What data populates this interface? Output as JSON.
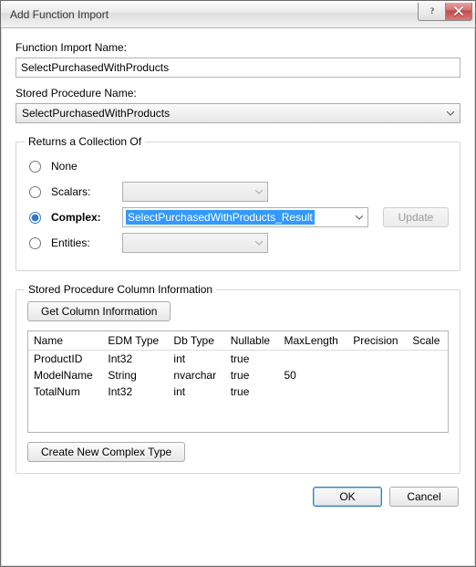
{
  "window": {
    "title": "Add Function Import"
  },
  "import": {
    "name_label": "Function Import Name:",
    "name_value": "SelectPurchasedWithProducts",
    "proc_label": "Stored Procedure Name:",
    "proc_value": "SelectPurchasedWithProducts"
  },
  "returns": {
    "legend": "Returns a Collection Of",
    "none_label": "None",
    "scalars_label": "Scalars:",
    "complex_label": "Complex:",
    "entities_label": "Entities:",
    "complex_value": "SelectPurchasedWithProducts_Result",
    "update_btn": "Update"
  },
  "colinfo": {
    "legend": "Stored Procedure Column Information",
    "getcols_btn": "Get Column Information",
    "headers": {
      "name": "Name",
      "edm": "EDM Type",
      "db": "Db Type",
      "nullable": "Nullable",
      "maxlen": "MaxLength",
      "precision": "Precision",
      "scale": "Scale"
    },
    "rows": [
      {
        "name": "ProductID",
        "edm": "Int32",
        "db": "int",
        "nullable": "true",
        "maxlen": "",
        "precision": "",
        "scale": ""
      },
      {
        "name": "ModelName",
        "edm": "String",
        "db": "nvarchar",
        "nullable": "true",
        "maxlen": "50",
        "precision": "",
        "scale": ""
      },
      {
        "name": "TotalNum",
        "edm": "Int32",
        "db": "int",
        "nullable": "true",
        "maxlen": "",
        "precision": "",
        "scale": ""
      }
    ],
    "create_btn": "Create New Complex Type"
  },
  "footer": {
    "ok": "OK",
    "cancel": "Cancel"
  }
}
